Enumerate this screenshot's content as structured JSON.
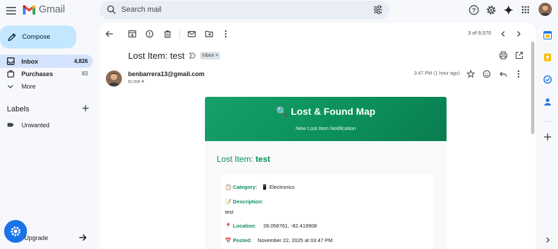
{
  "app": {
    "name": "Gmail"
  },
  "search": {
    "placeholder": "Search mail"
  },
  "sidebar": {
    "compose_label": "Compose",
    "items": [
      {
        "label": "Inbox",
        "count": "4,826"
      },
      {
        "label": "Purchases",
        "count": "83"
      },
      {
        "label": "More",
        "count": ""
      }
    ],
    "labels_title": "Labels",
    "labels": [
      {
        "label": "Unwanted"
      }
    ],
    "upgrade_label": "Upgrade"
  },
  "toolbar": {
    "pager": "3 of 9,570"
  },
  "email": {
    "subject": "Lost Item: test",
    "chip": "Inbox ×",
    "sender": "benbarrera13@gmail.com",
    "to": "to me ▾",
    "timestamp": "3:47 PM (1 hour ago)",
    "card": {
      "title": "🔍 Lost & Found Map",
      "subtitle": "New Lost Item Notification",
      "item_heading_prefix": "Lost Item: ",
      "item_heading_name": "test",
      "category_key": "📋 Category:",
      "category_val": "📱 Electronics",
      "description_key": "📝 Description:",
      "description_val": "test",
      "location_key": "📍 Location:",
      "location_val": "28.058761, -82.419908",
      "posted_key": "📅 Posted:",
      "posted_val": "November 22, 2025 at 03:47 PM"
    }
  },
  "colors": {
    "accent_green": "#0b8f5a",
    "compose_bg": "#c2e7ff",
    "inbox_selected_bg": "#d3e3fd",
    "search_bg": "#e9eef6"
  }
}
